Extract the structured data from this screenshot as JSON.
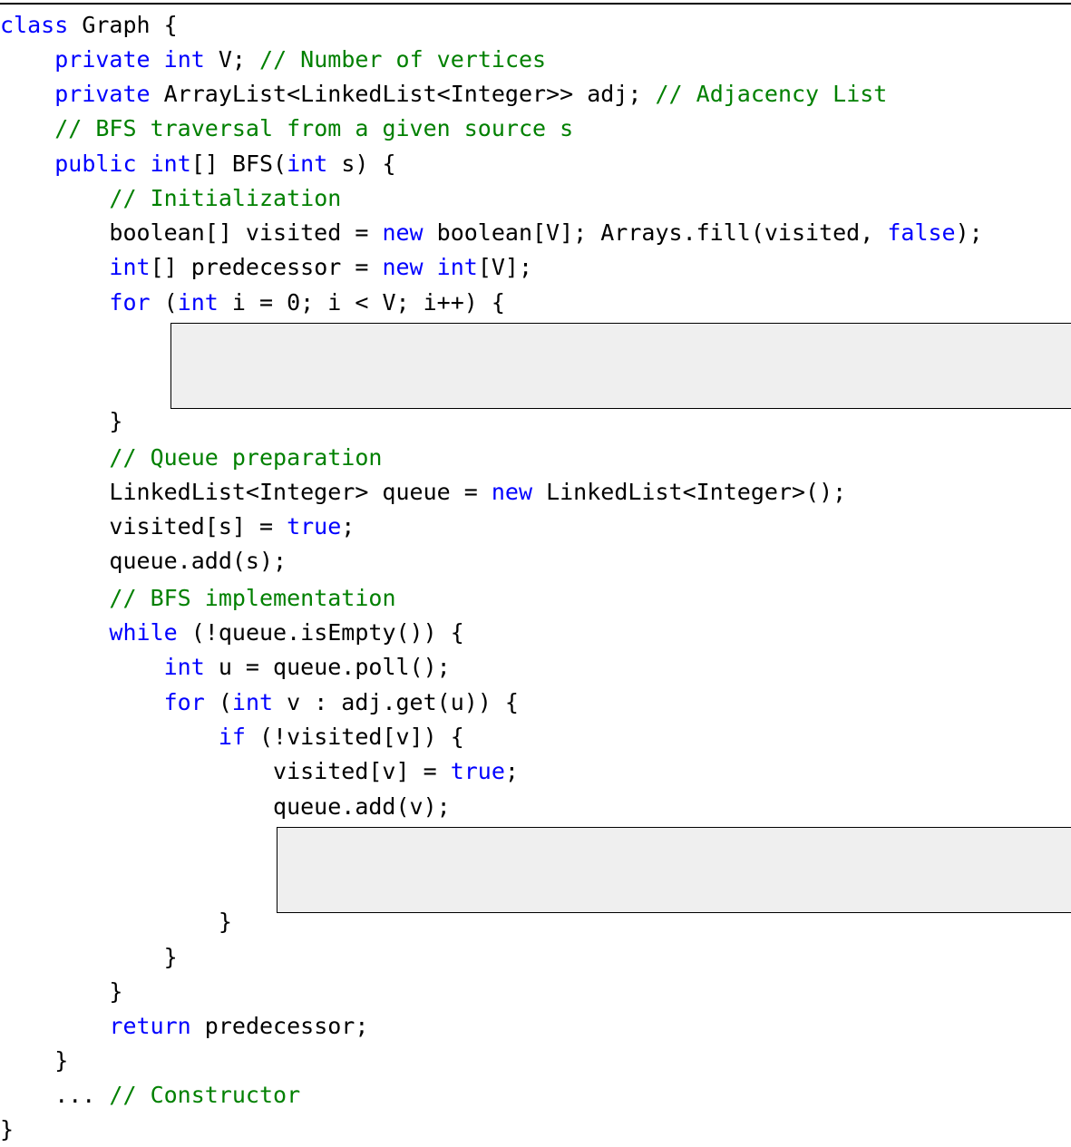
{
  "code": {
    "lines": [
      [
        {
          "t": "class",
          "c": "kw"
        },
        {
          "t": " Graph {",
          "c": ""
        }
      ],
      [
        {
          "t": "    ",
          "c": ""
        },
        {
          "t": "private",
          "c": "kw"
        },
        {
          "t": " ",
          "c": ""
        },
        {
          "t": "int",
          "c": "kw"
        },
        {
          "t": " V; ",
          "c": ""
        },
        {
          "t": "// Number of vertices",
          "c": "cm"
        }
      ],
      [
        {
          "t": "    ",
          "c": ""
        },
        {
          "t": "private",
          "c": "kw"
        },
        {
          "t": " ArrayList<LinkedList<Integer>> adj; ",
          "c": ""
        },
        {
          "t": "// Adjacency List",
          "c": "cm"
        }
      ],
      [
        {
          "t": "    ",
          "c": ""
        },
        {
          "t": "// BFS traversal from a given source s",
          "c": "cm"
        }
      ],
      [
        {
          "t": "    ",
          "c": ""
        },
        {
          "t": "public",
          "c": "kw"
        },
        {
          "t": " ",
          "c": ""
        },
        {
          "t": "int",
          "c": "kw"
        },
        {
          "t": "[] BFS(",
          "c": ""
        },
        {
          "t": "int",
          "c": "kw"
        },
        {
          "t": " s) {",
          "c": ""
        }
      ],
      [
        {
          "t": "        ",
          "c": ""
        },
        {
          "t": "// Initialization",
          "c": "cm"
        }
      ],
      [
        {
          "t": "        boolean[] visited = ",
          "c": ""
        },
        {
          "t": "new",
          "c": "kw"
        },
        {
          "t": " boolean[V]; Arrays.fill(visited, ",
          "c": ""
        },
        {
          "t": "false",
          "c": "kw"
        },
        {
          "t": ");",
          "c": ""
        }
      ],
      [
        {
          "t": "        ",
          "c": ""
        },
        {
          "t": "int",
          "c": "kw"
        },
        {
          "t": "[] predecessor = ",
          "c": ""
        },
        {
          "t": "new",
          "c": "kw"
        },
        {
          "t": " ",
          "c": ""
        },
        {
          "t": "int",
          "c": "kw"
        },
        {
          "t": "[V];",
          "c": ""
        }
      ],
      [
        {
          "t": "        ",
          "c": ""
        },
        {
          "t": "for",
          "c": "kw"
        },
        {
          "t": " (",
          "c": ""
        },
        {
          "t": "int",
          "c": "kw"
        },
        {
          "t": " i = 0; i < V; i++) {",
          "c": ""
        }
      ],
      [
        {
          "t": "        }",
          "c": ""
        }
      ],
      [
        {
          "t": "        ",
          "c": ""
        },
        {
          "t": "// Queue preparation",
          "c": "cm"
        }
      ],
      [
        {
          "t": "        LinkedList<Integer> queue = ",
          "c": ""
        },
        {
          "t": "new",
          "c": "kw"
        },
        {
          "t": " LinkedList<Integer>();",
          "c": ""
        }
      ],
      [
        {
          "t": "        visited[s] = ",
          "c": ""
        },
        {
          "t": "true",
          "c": "kw"
        },
        {
          "t": ";",
          "c": ""
        }
      ],
      [
        {
          "t": "        queue.add(s);",
          "c": ""
        }
      ],
      [
        {
          "t": "        ",
          "c": ""
        },
        {
          "t": "// BFS implementation",
          "c": "cm"
        }
      ],
      [
        {
          "t": "        ",
          "c": ""
        },
        {
          "t": "while",
          "c": "kw"
        },
        {
          "t": " (!queue.isEmpty()) {",
          "c": ""
        }
      ],
      [
        {
          "t": "            ",
          "c": ""
        },
        {
          "t": "int",
          "c": "kw"
        },
        {
          "t": " u = queue.poll();",
          "c": ""
        }
      ],
      [
        {
          "t": "            ",
          "c": ""
        },
        {
          "t": "for",
          "c": "kw"
        },
        {
          "t": " (",
          "c": ""
        },
        {
          "t": "int",
          "c": "kw"
        },
        {
          "t": " v : adj.get(u)) {",
          "c": ""
        }
      ],
      [
        {
          "t": "                ",
          "c": ""
        },
        {
          "t": "if",
          "c": "kw"
        },
        {
          "t": " (!visited[v]) {",
          "c": ""
        }
      ],
      [
        {
          "t": "                    visited[v] = ",
          "c": ""
        },
        {
          "t": "true",
          "c": "kw"
        },
        {
          "t": ";",
          "c": ""
        }
      ],
      [
        {
          "t": "                    queue.add(v);",
          "c": ""
        }
      ],
      [
        {
          "t": "                }",
          "c": ""
        }
      ],
      [
        {
          "t": "            }",
          "c": ""
        }
      ],
      [
        {
          "t": "        }",
          "c": ""
        }
      ],
      [
        {
          "t": "        ",
          "c": ""
        },
        {
          "t": "return",
          "c": "kw"
        },
        {
          "t": " predecessor;",
          "c": ""
        }
      ],
      [
        {
          "t": "    }",
          "c": ""
        }
      ],
      [
        {
          "t": "    ... ",
          "c": ""
        },
        {
          "t": "// Constructor",
          "c": "cm"
        }
      ],
      [
        {
          "t": "}",
          "c": ""
        }
      ]
    ]
  },
  "colors": {
    "keyword": "#0000ff",
    "comment": "#008000",
    "text": "#000000",
    "blank_fill": "#efefef"
  }
}
